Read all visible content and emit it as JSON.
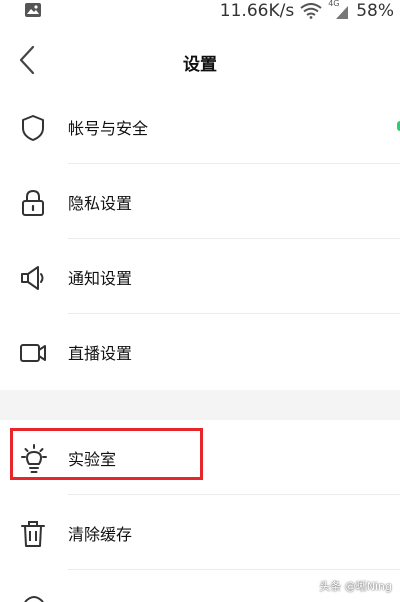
{
  "status_bar": {
    "speed": "11.66K/s",
    "network_label": "4G",
    "battery": "58%"
  },
  "header": {
    "title": "设置",
    "back_icon": "chevron-left-icon"
  },
  "settings": [
    {
      "label": "帐号与安全",
      "icon": "shield-icon"
    },
    {
      "label": "隐私设置",
      "icon": "lock-icon"
    },
    {
      "label": "通知设置",
      "icon": "speaker-icon"
    },
    {
      "label": "直播设置",
      "icon": "video-camera-icon"
    },
    {
      "label": "实验室",
      "icon": "lightbulb-icon"
    },
    {
      "label": "清除缓存",
      "icon": "trash-icon"
    }
  ],
  "watermark": "头条 @晰Ning",
  "colors": {
    "highlight": "#e8262a",
    "indicator": "#2ecc71",
    "section_gap": "#f4f4f4"
  }
}
